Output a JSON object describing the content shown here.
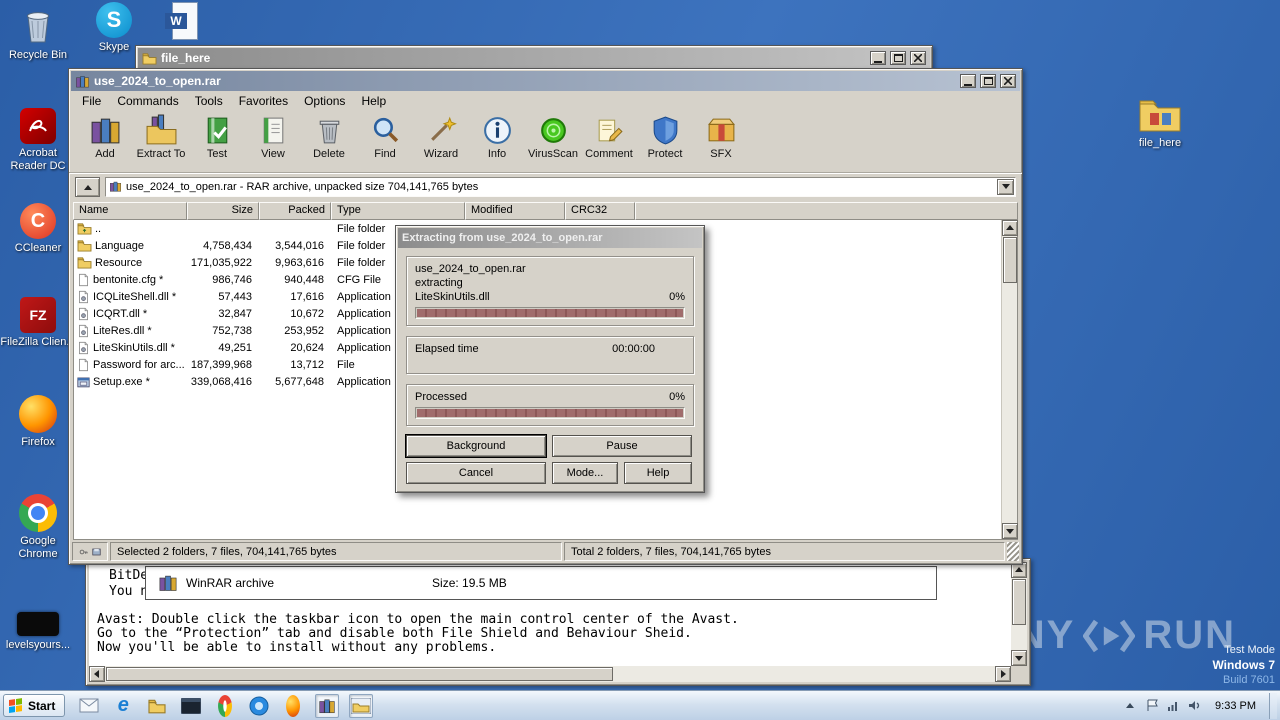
{
  "glyphs": {
    "skype": "S",
    "word": "W",
    "filezilla": "FZ",
    "ccleaner": "C",
    "ie": "e"
  },
  "desktop": {
    "left_icons": [
      {
        "icon": "recycle-bin-icon",
        "label": "Recycle Bin"
      },
      {
        "icon": "acrobat-reader-icon",
        "label": "Acrobat Reader DC"
      },
      {
        "icon": "ccleaner-icon",
        "label": "CCleaner"
      },
      {
        "icon": "filezilla-icon",
        "label": "FileZilla Clien..."
      },
      {
        "icon": "firefox-icon",
        "label": "Firefox"
      },
      {
        "icon": "chrome-icon",
        "label": "Google Chrome"
      },
      {
        "icon": "black-app-icon",
        "label": "levelsyours..."
      }
    ],
    "top_icons": [
      {
        "icon": "skype-icon",
        "label": "Skype"
      },
      {
        "icon": "word-document-icon",
        "label": ""
      }
    ],
    "right_icons": [
      {
        "icon": "folder-icon",
        "label": "file_here"
      }
    ]
  },
  "explorer": {
    "title": "file_here"
  },
  "winrar": {
    "title": "use_2024_to_open.rar",
    "menu": [
      "File",
      "Commands",
      "Tools",
      "Favorites",
      "Options",
      "Help"
    ],
    "toolbar": [
      {
        "label": "Add",
        "icon": "add-books-icon"
      },
      {
        "label": "Extract To",
        "icon": "extract-folder-icon"
      },
      {
        "label": "Test",
        "icon": "test-book-icon"
      },
      {
        "label": "View",
        "icon": "view-book-icon"
      },
      {
        "label": "Delete",
        "icon": "delete-trash-icon"
      },
      {
        "label": "Find",
        "icon": "find-magnifier-icon"
      },
      {
        "label": "Wizard",
        "icon": "wizard-wand-icon"
      },
      {
        "label": "Info",
        "icon": "info-icon"
      },
      {
        "label": "VirusScan",
        "icon": "virus-scan-icon"
      },
      {
        "label": "Comment",
        "icon": "comment-note-icon"
      },
      {
        "label": "Protect",
        "icon": "protect-shield-icon"
      },
      {
        "label": "SFX",
        "icon": "sfx-box-icon"
      }
    ],
    "address": "use_2024_to_open.rar - RAR archive, unpacked size 704,141,765 bytes",
    "columns": [
      "Name",
      "Size",
      "Packed",
      "Type",
      "Modified",
      "CRC32"
    ],
    "rows": [
      {
        "name": "..",
        "size": "",
        "packed": "",
        "type": "File folder"
      },
      {
        "name": "Language",
        "size": "4,758,434",
        "packed": "3,544,016",
        "type": "File folder"
      },
      {
        "name": "Resource",
        "size": "171,035,922",
        "packed": "9,963,616",
        "type": "File folder"
      },
      {
        "name": "bentonite.cfg *",
        "size": "986,746",
        "packed": "940,448",
        "type": "CFG File"
      },
      {
        "name": "ICQLiteShell.dll *",
        "size": "57,443",
        "packed": "17,616",
        "type": "Application"
      },
      {
        "name": "ICQRT.dll *",
        "size": "32,847",
        "packed": "10,672",
        "type": "Application"
      },
      {
        "name": "LiteRes.dll *",
        "size": "752,738",
        "packed": "253,952",
        "type": "Application"
      },
      {
        "name": "LiteSkinUtils.dll *",
        "size": "49,251",
        "packed": "20,624",
        "type": "Application"
      },
      {
        "name": "Password for arc...",
        "size": "187,399,968",
        "packed": "13,712",
        "type": "File"
      },
      {
        "name": "Setup.exe *",
        "size": "339,068,416",
        "packed": "5,677,648",
        "type": "Application"
      }
    ],
    "status_left": "Selected 2 folders, 7 files, 704,141,765 bytes",
    "status_right": "Total 2 folders, 7 files, 704,141,765 bytes"
  },
  "dialog": {
    "title": "Extracting from use_2024_to_open.rar",
    "archive": "use_2024_to_open.rar",
    "action": "extracting",
    "file": "LiteSkinUtils.dll",
    "file_percent": "0%",
    "elapsed_label": "Elapsed time",
    "elapsed_value": "00:00:00",
    "processed_label": "Processed",
    "processed_percent": "0%",
    "btn_background": "Background",
    "btn_pause": "Pause",
    "btn_cancel": "Cancel",
    "btn_mode": "Mode...",
    "btn_help": "Help",
    "progress_color": "#9c6a6a"
  },
  "readme": {
    "clip1": "BitDe",
    "clip2": "You n",
    "file_type": "WinRAR archive",
    "file_size": "Size: 19.5 MB",
    "line1": "Avast: Double click the taskbar icon to open the main control center of the Avast.",
    "line2": "Go to the “Protection” tab and disable both File Shield and Behaviour Sheid.",
    "line3": "Now you'll be able to install without any problems."
  },
  "taskbar": {
    "start": "Start",
    "clock": "9:33 PM",
    "quicklaunch": [
      "mail-icon",
      "internet-explorer-icon",
      "folder-icon",
      "console-icon",
      "chrome-icon",
      "blue-app-icon",
      "firefox-icon",
      "winrar-icon",
      "windows-explorer-icon"
    ],
    "tray": [
      "hidden-icons-chevron",
      "action-center-icon",
      "network-icon",
      "volume-icon"
    ]
  },
  "watermark": {
    "any": "ANY",
    "run": "RUN",
    "mode": "Test Mode",
    "os": "Windows 7",
    "build": "Build 7601"
  }
}
